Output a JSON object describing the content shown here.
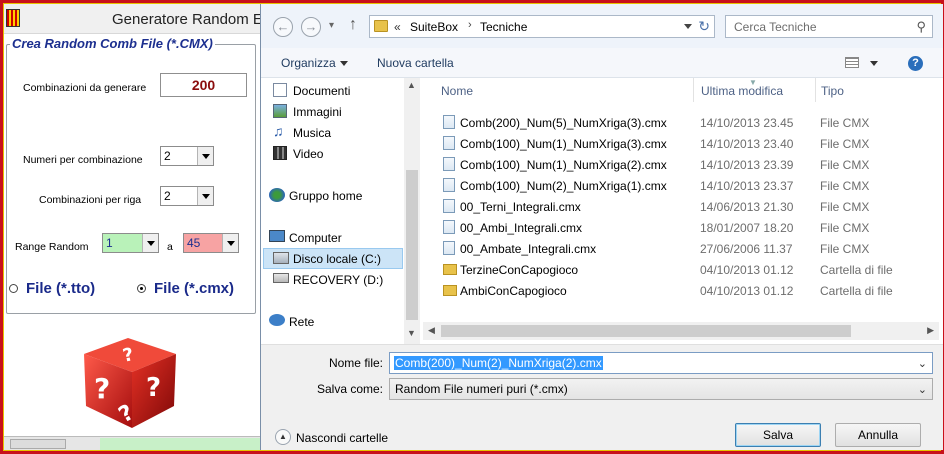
{
  "left_app": {
    "title": "Generatore Random E",
    "group_title": "Crea Random Comb File (*.CMX)",
    "combinations_label": "Combinazioni da generare",
    "combinations_value": "200",
    "numbers_per_combo_label": "Numeri per combinazione",
    "numbers_per_combo_value": "2",
    "combos_per_row_label": "Combinazioni per riga",
    "combos_per_row_value": "2",
    "range_label": "Range Random",
    "range_from": "1",
    "range_sep": "a",
    "range_to": "45",
    "radio_tto_label": "File (*.tto)",
    "radio_cmx_label": "File (*.cmx)",
    "radio_selected": "cmx",
    "colors": {
      "title_blue": "#1c2f8f",
      "value_red": "#8a0c0c",
      "range_from_bg": "#b9f2b9",
      "range_to_bg": "#f7a3a3"
    }
  },
  "dialog": {
    "nav": {
      "back_icon": "back-arrow-icon",
      "forward_icon": "forward-arrow-icon",
      "up_icon": "up-arrow-icon",
      "breadcrumb_prefix": "«",
      "breadcrumb_1": "SuiteBox",
      "breadcrumb_sep": "›",
      "breadcrumb_2": "Tecniche",
      "search_placeholder": "Cerca Tecniche"
    },
    "toolbar": {
      "organize": "Organizza",
      "new_folder": "Nuova cartella"
    },
    "sidebar": [
      {
        "label": "Documenti",
        "icon": "documents-icon"
      },
      {
        "label": "Immagini",
        "icon": "pictures-icon"
      },
      {
        "label": "Musica",
        "icon": "music-icon"
      },
      {
        "label": "Video",
        "icon": "video-icon"
      },
      {
        "label": "Gruppo home",
        "icon": "homegroup-icon"
      },
      {
        "label": "Computer",
        "icon": "computer-icon"
      },
      {
        "label": "Disco locale (C:)",
        "icon": "local-disk-icon",
        "selected": true
      },
      {
        "label": "RECOVERY (D:)",
        "icon": "drive-icon"
      },
      {
        "label": "Rete",
        "icon": "network-icon"
      }
    ],
    "columns": {
      "name": "Nome",
      "modified": "Ultima modifica",
      "type": "Tipo"
    },
    "files": [
      {
        "name": "Comb(200)_Num(5)_NumXriga(3).cmx",
        "modified": "14/10/2013 23.45",
        "type": "File CMX",
        "kind": "file"
      },
      {
        "name": "Comb(100)_Num(1)_NumXriga(3).cmx",
        "modified": "14/10/2013 23.40",
        "type": "File CMX",
        "kind": "file"
      },
      {
        "name": "Comb(100)_Num(1)_NumXriga(2).cmx",
        "modified": "14/10/2013 23.39",
        "type": "File CMX",
        "kind": "file"
      },
      {
        "name": "Comb(100)_Num(2)_NumXriga(1).cmx",
        "modified": "14/10/2013 23.37",
        "type": "File CMX",
        "kind": "file"
      },
      {
        "name": "00_Terni_Integrali.cmx",
        "modified": "14/06/2013 21.30",
        "type": "File CMX",
        "kind": "file"
      },
      {
        "name": "00_Ambi_Integrali.cmx",
        "modified": "18/01/2007 18.20",
        "type": "File CMX",
        "kind": "file"
      },
      {
        "name": "00_Ambate_Integrali.cmx",
        "modified": "27/06/2006 11.37",
        "type": "File CMX",
        "kind": "file"
      },
      {
        "name": "TerzineConCapogioco",
        "modified": "04/10/2013 01.12",
        "type": "Cartella di file",
        "kind": "folder"
      },
      {
        "name": "AmbiConCapogioco",
        "modified": "04/10/2013 01.12",
        "type": "Cartella di file",
        "kind": "folder"
      }
    ],
    "filename_label": "Nome file:",
    "filename_value": "Comb(200)_Num(2)_NumXriga(2).cmx",
    "filetype_label": "Salva come:",
    "filetype_value": "Random File numeri puri (*.cmx)",
    "hide_folders": "Nascondi cartelle",
    "save_button": "Salva",
    "cancel_button": "Annulla"
  }
}
